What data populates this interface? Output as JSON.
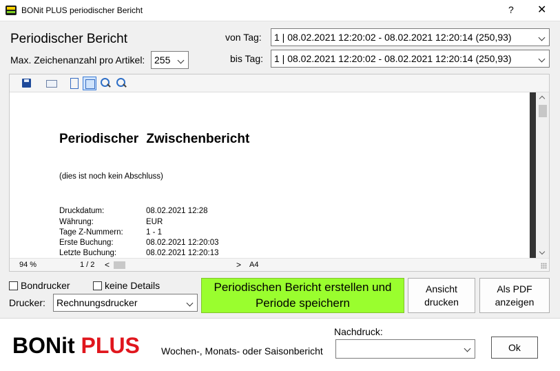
{
  "window": {
    "title": "BONit PLUS periodischer Bericht",
    "help_label": "?",
    "close_label": "✕"
  },
  "header": {
    "title": "Periodischer Bericht",
    "max_chars_label": "Max. Zeichenanzahl pro Artikel:",
    "max_chars_value": "255",
    "von_tag_label": "von Tag:",
    "von_tag_value": "1 | 08.02.2021 12:20:02 - 08.02.2021 12:20:14 (250,93)",
    "bis_tag_label": "bis Tag:",
    "bis_tag_value": "1 | 08.02.2021 12:20:02 - 08.02.2021 12:20:14 (250,93)"
  },
  "toolbar": {
    "icons": [
      "save-icon",
      "email-icon",
      "fit-page-icon",
      "fit-width-icon",
      "zoom-in-icon",
      "zoom-out-icon"
    ]
  },
  "report": {
    "title": "Periodischer Zwischenbericht",
    "subtitle": "(dies ist noch kein Abschluss)",
    "rows": [
      {
        "key": "Druckdatum:",
        "value": "08.02.2021   12:28"
      },
      {
        "key": "Währung:",
        "value": "EUR"
      },
      {
        "key": "Tage Z-Nummern:",
        "value": "1 - 1"
      },
      {
        "key": "Erste Buchung:",
        "value": "08.02.2021  12:20:03"
      },
      {
        "key": "Letzte Buchung:",
        "value": "08.02.2021  12:20:13"
      }
    ]
  },
  "status": {
    "zoom": "94 %",
    "page": "1 / 2",
    "scroll_left": "<",
    "scroll_right": ">",
    "format": "A4"
  },
  "options": {
    "bondrucker_label": "Bondrucker",
    "bondrucker_checked": false,
    "keine_details_label": "keine Details",
    "keine_details_checked": false,
    "drucker_label": "Drucker:",
    "drucker_value": "Rechnungsdrucker"
  },
  "buttons": {
    "create_line1": "Periodischen Bericht erstellen und",
    "create_line2": "Periode speichern",
    "preview_line1": "Ansicht",
    "preview_line2": "drucken",
    "pdf_line1": "Als PDF",
    "pdf_line2": "anzeigen",
    "ok": "Ok"
  },
  "footer": {
    "logo_bonit": "BONit",
    "logo_plus": "PLUS",
    "description": "Wochen-, Monats- oder Saisonbericht",
    "nachdruck_label": "Nachdruck:",
    "nachdruck_value": ""
  },
  "colors": {
    "create_button": "#9afe2e",
    "logo_plus": "#e0161d"
  }
}
